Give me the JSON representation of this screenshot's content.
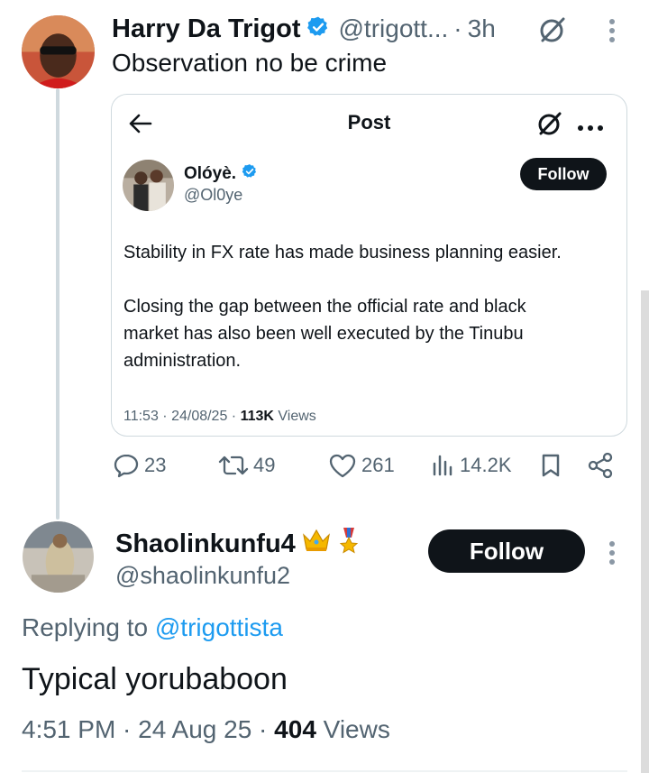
{
  "tweet": {
    "author_name": "Harry Da Trigot",
    "author_handle": "@trigott...",
    "time": "3h",
    "text": "Observation no be crime",
    "quote": {
      "header_title": "Post",
      "author_name": "Olóyè.",
      "author_handle": "@Ol0ye",
      "follow_label": "Follow",
      "paragraph1": "Stability in FX rate has made business planning easier.",
      "paragraph2_line1": "Closing the gap between the official rate and black",
      "paragraph2_line2": "market has also been well executed by the Tinubu",
      "paragraph2_line3": "administration.",
      "timestamp": "11:53 · 24/08/25 · ",
      "views_count": "113K",
      "views_label": " Views"
    },
    "actions": {
      "replies": "23",
      "reposts": "49",
      "likes": "261",
      "views": "14.2K"
    }
  },
  "reply": {
    "author_name": "Shaolinkunfu4",
    "badges": [
      "crown-emoji",
      "medal-emoji"
    ],
    "author_handle": "@shaolinkunfu2",
    "follow_label": "Follow",
    "replying_prefix": "Replying to ",
    "replying_mention": "@trigottista",
    "text": "Typical yorubaboon",
    "timestamp": "4:51 PM · 24 Aug 25 · ",
    "views_count": "404",
    "views_label": " Views"
  },
  "colors": {
    "text": "#0f1419",
    "secondary": "#536471",
    "verified": "#1d9bf0",
    "link": "#1d9bf0",
    "border": "#cfd9de",
    "button": "#0f1419"
  }
}
